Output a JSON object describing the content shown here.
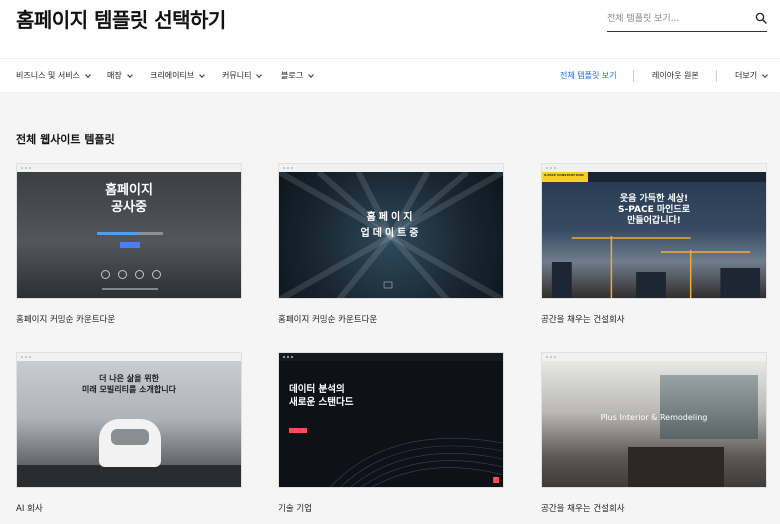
{
  "header": {
    "title": "홈페이지 템플릿 선택하기",
    "search_placeholder": "전체 템플릿 보기..."
  },
  "nav": {
    "categories": [
      {
        "label": "비즈니스 및 서비스"
      },
      {
        "label": "매장"
      },
      {
        "label": "크리에이티브"
      },
      {
        "label": "커뮤니티"
      },
      {
        "label": "블로그"
      }
    ],
    "all_templates": "전체 템플릿 보기",
    "blank_layout": "레이아웃 원본",
    "more": "더보기",
    "active_color": "#116dff"
  },
  "section": {
    "title": "전체 웹사이트 템플릿"
  },
  "templates": [
    {
      "label": "홈페이지 커밍순 카운트다운",
      "hero": [
        "홈페이지",
        "공사중"
      ]
    },
    {
      "label": "홈페이지 커밍순 카운트다운",
      "hero": [
        "홈페이지",
        "업데이트중"
      ]
    },
    {
      "label": "공간을 채우는 건설회사",
      "hero": [
        "웃음 가득한 세상!",
        "S-PACE 마인드로",
        "만들어갑니다!"
      ],
      "brand_band": "S-PACE CONSTRUCTION"
    },
    {
      "label": "AI 회사",
      "hero": [
        "더 나은 삶을 위한",
        "미래 모빌리티를 소개합니다"
      ]
    },
    {
      "label": "기술 기업",
      "hero": [
        "데이터 분석의",
        "새로운 스탠다드"
      ]
    },
    {
      "label": "공간을 채우는 건설회사",
      "hero": [
        "Plus Interior & Remodeling"
      ]
    }
  ]
}
